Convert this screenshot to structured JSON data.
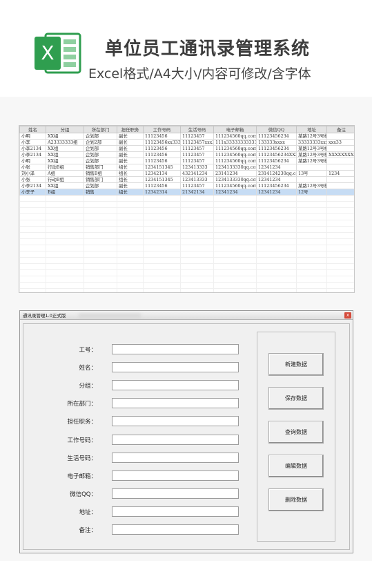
{
  "banner": {
    "logo_letter": "X",
    "title": "单位员工通讯录管理系统",
    "subtitle": "Excel格式/A4大小/内容可修改/含字体",
    "brand_color": "#2f9e4f"
  },
  "sheet": {
    "headers": [
      "姓名",
      "分组",
      "所在部门",
      "担任职务",
      "工作号码",
      "生活号码",
      "电子邮箱",
      "微信QQ",
      "地址",
      "备注"
    ],
    "rows": [
      [
        "小明",
        "XX组",
        "企划部",
        "副长",
        "11123456",
        "11123457",
        "111234560qq.com",
        "11123456234",
        "某路12号3号楼",
        ""
      ],
      [
        "小李",
        "A23333333组",
        "企划2部",
        "副长",
        "11123456xx33333",
        "11123457xxx333",
        "111x333333333332",
        "133333xxxx",
        "33333333xxxx",
        "xxx33"
      ],
      [
        "小李2134",
        "XX组",
        "企划部",
        "副长",
        "11123456",
        "11123457",
        "111234560qq.com",
        "11123456234",
        "某路12号3号楼",
        ""
      ],
      [
        "小李2134",
        "XX组",
        "企划部",
        "副长",
        "11123456",
        "11123457",
        "111234560qq.com",
        "11123456234XXXXXX",
        "某路12号3号楼",
        "XXXXXXXXXX"
      ],
      [
        "小明",
        "XX组",
        "企划部",
        "副长",
        "11123456",
        "11123457",
        "111234560qq.com",
        "11123456234",
        "某路12号3号楼",
        ""
      ],
      [
        "小张",
        "行动B组",
        "销售部门",
        "组长",
        "1234151345",
        "123413333",
        "1234133330qq.com",
        "12341234",
        "",
        ""
      ],
      [
        "刘小泽",
        "A组",
        "销售B组",
        "组长",
        "12342134",
        "432141234",
        "23141234",
        "2314124230qq.com",
        "13号",
        "1234"
      ],
      [
        "小张",
        "行动B组",
        "销售部门",
        "组长",
        "1234151345",
        "123413333",
        "1234133330qq.com",
        "12341234",
        "",
        ""
      ],
      [
        "小李2134",
        "XX组",
        "企划部",
        "副长",
        "11123456",
        "11123457",
        "111234560qq.com",
        "11123456234",
        "某路12号3号楼",
        ""
      ],
      [
        "小李子",
        "B组",
        "销售",
        "组长",
        "12342314",
        "21342134",
        "12341234",
        "12341234",
        "12号",
        ""
      ]
    ],
    "selected_row": 9
  },
  "dialog": {
    "title": "通讯录管理1.0正式版",
    "close_label": "x",
    "fields": [
      {
        "label": "工号：",
        "value": ""
      },
      {
        "label": "姓名：",
        "value": ""
      },
      {
        "label": "分组：",
        "value": ""
      },
      {
        "label": "所在部门：",
        "value": ""
      },
      {
        "label": "担任职务：",
        "value": ""
      },
      {
        "label": "工作号码：",
        "value": ""
      },
      {
        "label": "生活号码：",
        "value": ""
      },
      {
        "label": "电子邮箱：",
        "value": ""
      },
      {
        "label": "微信QQ：",
        "value": ""
      },
      {
        "label": "地址：",
        "value": ""
      },
      {
        "label": "备注：",
        "value": ""
      }
    ],
    "buttons": [
      "新建数据",
      "保存数据",
      "查询数据",
      "编辑数据",
      "删除数据"
    ]
  }
}
